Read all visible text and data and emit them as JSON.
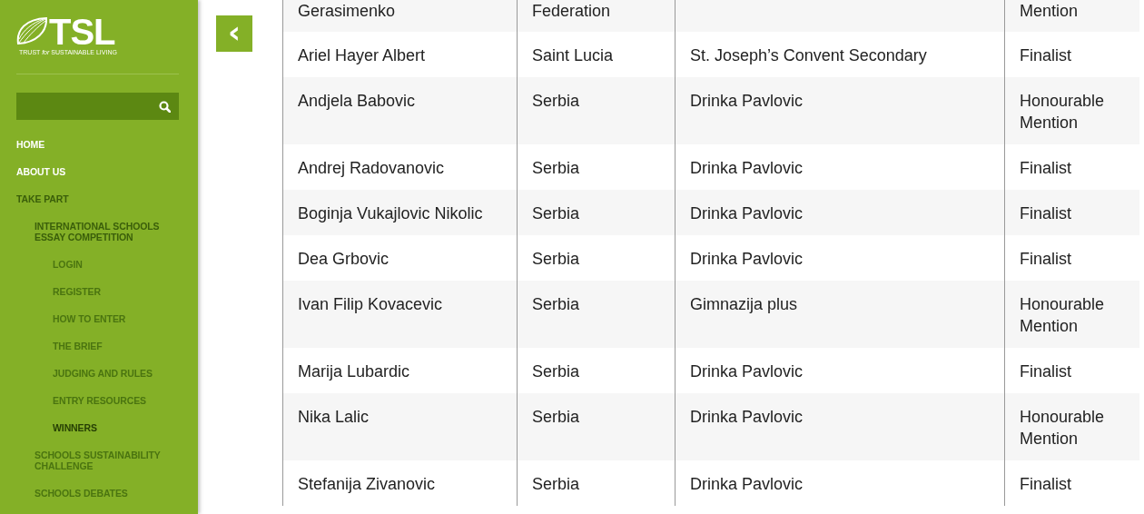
{
  "logo": {
    "wordmark": "TSL",
    "tagline": "TRUST *for* SUSTAINABLE LIVING"
  },
  "nav": [
    {
      "label": "HOME",
      "selected": false,
      "expanded": false
    },
    {
      "label": "ABOUT US",
      "selected": false,
      "expanded": false
    },
    {
      "label": "TAKE PART",
      "selected": false,
      "expanded": true,
      "children": [
        {
          "label": "INTERNATIONAL SCHOOLS ESSAY COMPETITION",
          "selected": false,
          "expanded": true,
          "children": [
            {
              "label": "LOGIN",
              "selected": false,
              "expanded": false
            },
            {
              "label": "REGISTER",
              "selected": false,
              "expanded": false
            },
            {
              "label": "HOW TO ENTER",
              "selected": false,
              "expanded": false
            },
            {
              "label": "THE BRIEF",
              "selected": false,
              "expanded": false
            },
            {
              "label": "JUDGING AND RULES",
              "selected": false,
              "expanded": false
            },
            {
              "label": "ENTRY RESOURCES",
              "selected": false,
              "expanded": false
            },
            {
              "label": "WINNERS",
              "selected": true,
              "expanded": false
            }
          ]
        },
        {
          "label": "SCHOOLS SUSTAINABILITY CHALLENGE",
          "selected": false,
          "expanded": false
        },
        {
          "label": "SCHOOLS DEBATES",
          "selected": false,
          "expanded": false
        }
      ]
    }
  ],
  "back_button": {
    "icon": "‹"
  },
  "table": {
    "rows": [
      {
        "cells": [
          "Gerasimenko",
          "Federation",
          "",
          "Mention"
        ],
        "cut": true
      },
      {
        "cells": [
          "Ariel Hayer Albert",
          "Saint Lucia",
          "St. Joseph’s Convent Secondary",
          "Finalist"
        ]
      },
      {
        "cells": [
          "Andjela Babovic",
          "Serbia",
          "Drinka Pavlovic",
          "Honourable Mention"
        ]
      },
      {
        "cells": [
          "Andrej Radovanovic",
          "Serbia",
          "Drinka Pavlovic",
          "Finalist"
        ]
      },
      {
        "cells": [
          "Boginja Vukajlovic Nikolic",
          "Serbia",
          "Drinka Pavlovic",
          "Finalist"
        ]
      },
      {
        "cells": [
          "Dea Grbovic",
          "Serbia",
          "Drinka Pavlovic",
          "Finalist"
        ]
      },
      {
        "cells": [
          "Ivan Filip Kovacevic",
          "Serbia",
          "Gimnazija plus",
          "Honourable Mention"
        ]
      },
      {
        "cells": [
          "Marija Lubardic",
          "Serbia",
          "Drinka Pavlovic",
          "Finalist"
        ]
      },
      {
        "cells": [
          "Nika Lalic",
          "Serbia",
          "Drinka Pavlovic",
          "Honourable Mention"
        ]
      },
      {
        "cells": [
          "Stefanija Zivanovic",
          "Serbia",
          "Drinka Pavlovic",
          "Finalist"
        ]
      }
    ]
  }
}
